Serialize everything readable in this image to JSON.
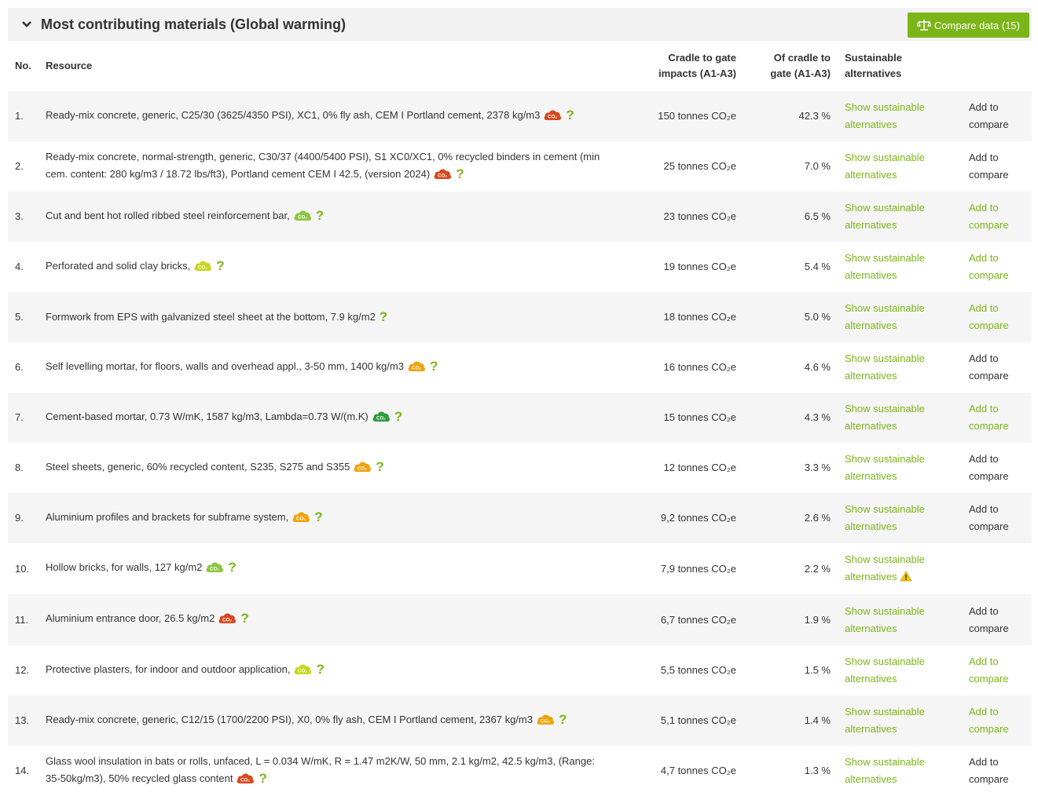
{
  "header": {
    "title": "Most contributing materials (Global warming)",
    "compare_button": "Compare data (15)"
  },
  "columns": {
    "no": "No.",
    "resource": "Resource",
    "impacts_l1": "Cradle to gate",
    "impacts_l2": "impacts (A1-A3)",
    "pct_l1": "Of cradle to",
    "pct_l2": "gate (A1-A3)",
    "sus_l1": "Sustainable",
    "sus_l2": "alternatives"
  },
  "labels": {
    "sus_l1": "Show sustainable",
    "sus_l2": "alternatives",
    "add_l1": "Add to",
    "add_l2": "compare"
  },
  "colors": {
    "accent": "#7cb518",
    "co2_red": "#d9471e",
    "co2_orange": "#f0a30a",
    "co2_yellow": "#c8d81a",
    "co2_lightgreen": "#8cc63f",
    "co2_darkgreen": "#2e9a3e"
  },
  "rows": [
    {
      "no": "1.",
      "resource": "Ready-mix concrete, generic, C25/30 (3625/4350 PSI), XC1, 0% fly ash, CEM I Portland cement, 2378 kg/m3",
      "co2": "red",
      "impact": "150 tonnes CO₂e",
      "pct": "42.3 %",
      "add_green": false,
      "warning": false
    },
    {
      "no": "2.",
      "resource": "Ready-mix concrete, normal-strength, generic, C30/37 (4400/5400 PSI), S1 XC0/XC1, 0% recycled binders in cement (min cem. content: 280 kg/m3 / 18.72 lbs/ft3), Portland cement CEM I 42.5, (version 2024)",
      "co2": "red",
      "impact": "25 tonnes CO₂e",
      "pct": "7.0 %",
      "add_green": false,
      "warning": false
    },
    {
      "no": "3.",
      "resource": "Cut and bent hot rolled ribbed steel reinforcement bar,",
      "co2": "lightgreen",
      "impact": "23 tonnes CO₂e",
      "pct": "6.5 %",
      "add_green": true,
      "warning": false
    },
    {
      "no": "4.",
      "resource": "Perforated and solid clay bricks,",
      "co2": "yellow",
      "impact": "19 tonnes CO₂e",
      "pct": "5.4 %",
      "add_green": true,
      "warning": false
    },
    {
      "no": "5.",
      "resource": "Formwork from EPS with galvanized steel sheet at the bottom, 7.9 kg/m2",
      "co2": "",
      "impact": "18 tonnes CO₂e",
      "pct": "5.0 %",
      "add_green": true,
      "warning": false
    },
    {
      "no": "6.",
      "resource": "Self levelling mortar, for floors, walls and overhead appl., 3-50 mm, 1400 kg/m3",
      "co2": "orange",
      "impact": "16 tonnes CO₂e",
      "pct": "4.6 %",
      "add_green": false,
      "warning": false
    },
    {
      "no": "7.",
      "resource": "Cement-based mortar, 0.73 W/mK, 1587 kg/m3, Lambda=0.73 W/(m.K)",
      "co2": "darkgreen",
      "impact": "15 tonnes CO₂e",
      "pct": "4.3 %",
      "add_green": true,
      "warning": false
    },
    {
      "no": "8.",
      "resource": "Steel sheets, generic, 60% recycled content, S235, S275 and S355",
      "co2": "orange",
      "impact": "12 tonnes CO₂e",
      "pct": "3.3 %",
      "add_green": false,
      "warning": false
    },
    {
      "no": "9.",
      "resource": "Aluminium profiles and brackets for subframe system,",
      "co2": "orange",
      "impact": "9,2 tonnes CO₂e",
      "pct": "2.6 %",
      "add_green": false,
      "warning": false
    },
    {
      "no": "10.",
      "resource": "Hollow bricks, for walls, 127 kg/m2",
      "co2": "lightgreen",
      "impact": "7,9 tonnes CO₂e",
      "pct": "2.2 %",
      "add_green": null,
      "warning": true
    },
    {
      "no": "11.",
      "resource": "Aluminium entrance door, 26.5 kg/m2",
      "co2": "red",
      "impact": "6,7 tonnes CO₂e",
      "pct": "1.9 %",
      "add_green": false,
      "warning": false
    },
    {
      "no": "12.",
      "resource": "Protective plasters, for indoor and outdoor application,",
      "co2": "yellow",
      "impact": "5,5 tonnes CO₂e",
      "pct": "1.5 %",
      "add_green": true,
      "warning": false
    },
    {
      "no": "13.",
      "resource": "Ready-mix concrete, generic, C12/15 (1700/2200 PSI), X0, 0% fly ash, CEM I Portland cement, 2367 kg/m3",
      "co2": "orange",
      "impact": "5,1 tonnes CO₂e",
      "pct": "1.4 %",
      "add_green": true,
      "warning": false
    },
    {
      "no": "14.",
      "resource": "Glass wool insulation in bats or rolls, unfaced, L = 0.034 W/mK, R = 1.47 m2K/W, 50 mm, 2.1 kg/m2, 42.5 kg/m3, (Range: 35-50kg/m3), 50% recycled glass content",
      "co2": "red",
      "impact": "4,7 tonnes CO₂e",
      "pct": "1.3 %",
      "add_green": false,
      "warning": false
    }
  ]
}
